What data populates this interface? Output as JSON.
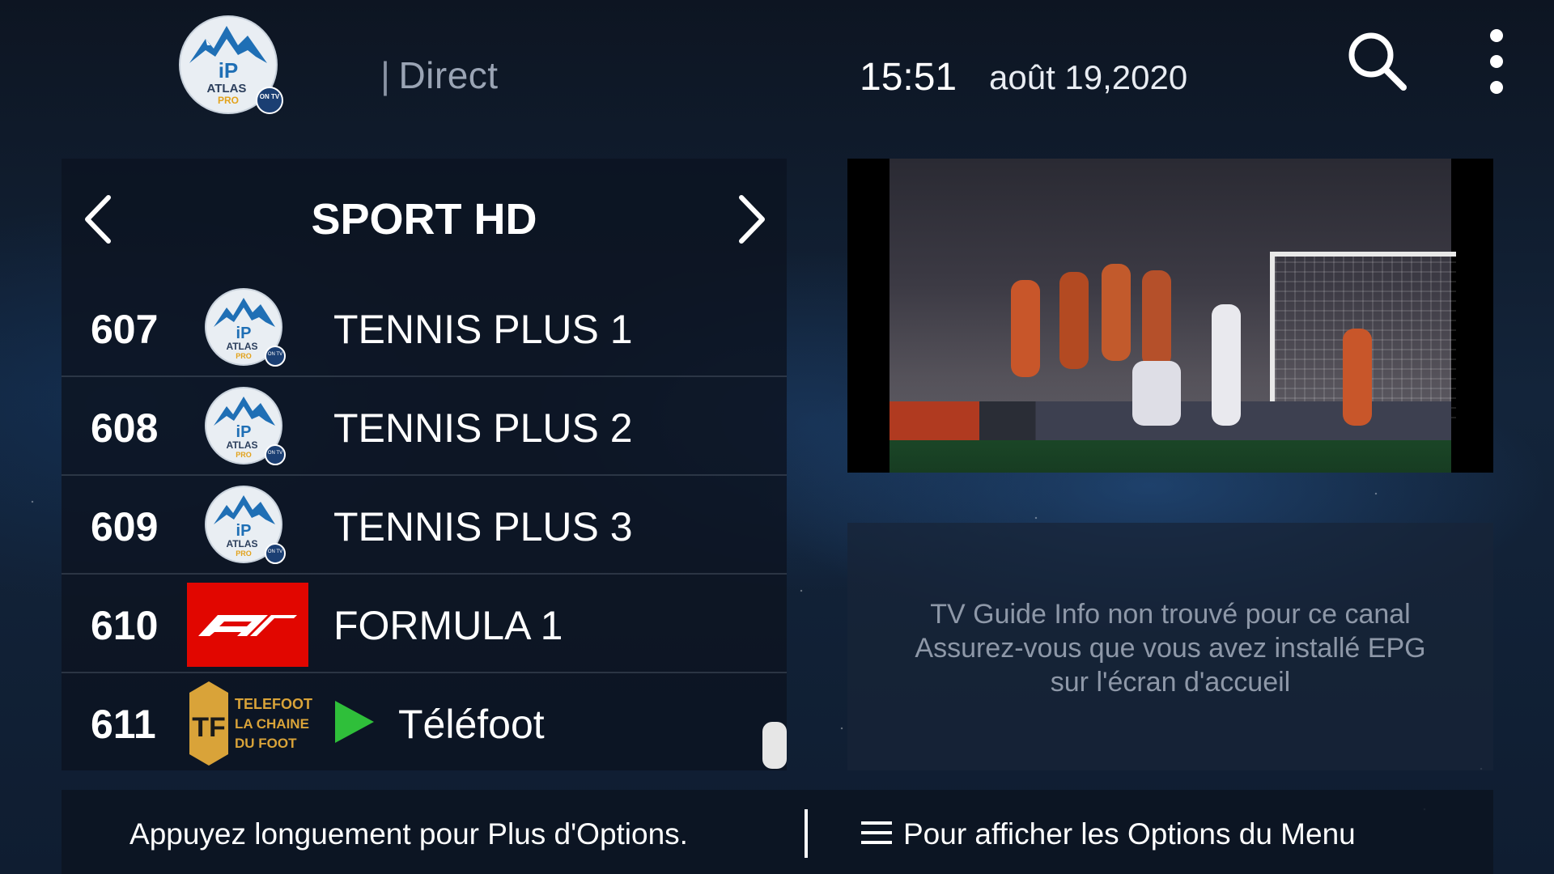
{
  "header": {
    "logo_icon": "atlas-pro-ontv-logo",
    "section_label": "Direct",
    "time": "15:51",
    "date": "août 19,2020",
    "search_icon": "search-icon",
    "more_icon": "more-vertical-icon"
  },
  "channel_list": {
    "group_title": "SPORT HD",
    "channels": [
      {
        "number": "607",
        "name": "TENNIS PLUS 1",
        "logo": "atlas-pro-logo"
      },
      {
        "number": "608",
        "name": "TENNIS PLUS 2",
        "logo": "atlas-pro-logo"
      },
      {
        "number": "609",
        "name": "TENNIS PLUS 3",
        "logo": "atlas-pro-logo"
      },
      {
        "number": "610",
        "name": "FORMULA 1",
        "logo": "f1-logo"
      },
      {
        "number": "611",
        "name": "Téléfoot",
        "logo": "telefoot-logo",
        "playing": true
      }
    ]
  },
  "preview": {
    "content": "live-football-video"
  },
  "epg": {
    "line1": "TV Guide Info non trouvé pour ce canal",
    "line2": "Assurez-vous que vous avez installé EPG",
    "line3": "sur l'écran d'accueil"
  },
  "footer": {
    "left_hint": "Appuyez longuement pour Plus d'Options.",
    "right_hint": "Pour afficher les Options du Menu"
  },
  "logos": {
    "atlas_brand": "ATLAS",
    "atlas_sub": "PRO",
    "ontv": "ON TV",
    "telefoot_line1": "TELEFOOT",
    "telefoot_line2": "LA CHAINE",
    "telefoot_line3": "DU FOOT",
    "telefoot_mark": "TF"
  },
  "colors": {
    "accent_green": "#2fbf3a",
    "f1_red": "#e10600",
    "telefoot_gold": "#d9a339"
  }
}
